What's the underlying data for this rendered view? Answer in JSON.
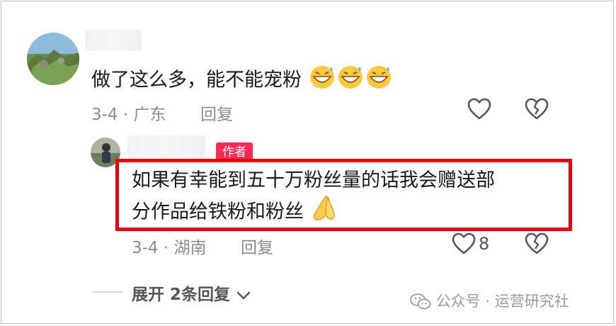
{
  "comment": {
    "text": "做了这么多，能不能宠粉",
    "date_location": "3-4 · 广东",
    "reply_label": "回复"
  },
  "reply": {
    "author_badge": "作者",
    "text_line1": "如果有幸能到五十万粉丝量的话我会赠送部",
    "text_line2": "分作品给铁粉和粉丝",
    "date_location": "3-4 · 湖南",
    "reply_label": "回复",
    "like_count": "8"
  },
  "expand_replies": {
    "prefix": "展开",
    "count": "2",
    "suffix": "条回复"
  },
  "watermark": {
    "text": "公众号 · 运营研究社"
  },
  "colors": {
    "author_badge": "#fe2c55",
    "highlight_border": "#e60012",
    "meta_text": "#8a8b91"
  }
}
